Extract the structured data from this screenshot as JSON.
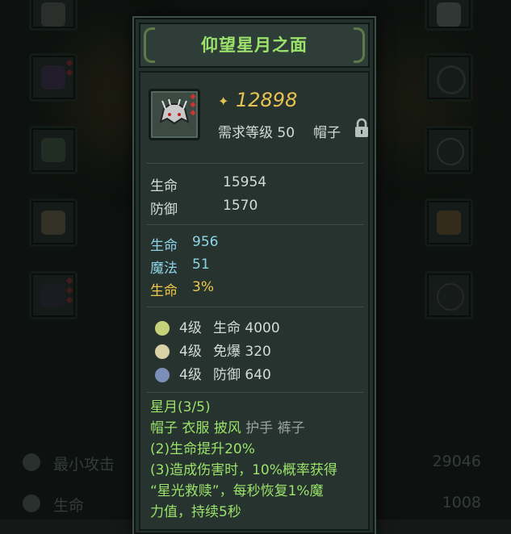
{
  "item": {
    "name": "仰望星月之面",
    "price": "12898",
    "requirement": "需求等级 50",
    "slot_type": "帽子"
  },
  "base_stats": [
    {
      "label": "生命",
      "value": "15954"
    },
    {
      "label": "防御",
      "value": "1570"
    }
  ],
  "bonus_stats": [
    {
      "label": "生命",
      "value": "956",
      "color": "#8fd3e6"
    },
    {
      "label": "魔法",
      "value": "51",
      "color": "#8fd3e6"
    },
    {
      "label": "生命",
      "value": "3%",
      "color": "#f0c84a"
    }
  ],
  "gems": [
    {
      "level": "4级",
      "effect": "生命 4000",
      "color": "#c6d27a"
    },
    {
      "level": "4级",
      "effect": "免爆 320",
      "color": "#d9d4a8"
    },
    {
      "level": "4级",
      "effect": "防御 640",
      "color": "#7b8fb8"
    }
  ],
  "set": {
    "header": "星月(3/5)",
    "pieces": [
      {
        "name": "帽子",
        "owned": true
      },
      {
        "name": "衣服",
        "owned": true
      },
      {
        "name": "披风",
        "owned": true
      },
      {
        "name": "护手",
        "owned": false
      },
      {
        "name": "裤子",
        "owned": false
      }
    ],
    "effect_2": "(2)生命提升20%",
    "effect_3_lines": [
      "(3)造成伤害时，10%概率获得",
      "“星光救赎”，每秒恢复1%魔",
      "力值，持续5秒"
    ]
  },
  "background_stats": [
    {
      "label": "最小攻击",
      "value": "29046"
    },
    {
      "label": "生命",
      "value": "1008"
    }
  ],
  "colors": {
    "title_green": "#9be36a",
    "price_gold": "#e8c250",
    "text_main": "#d4dcd8"
  }
}
